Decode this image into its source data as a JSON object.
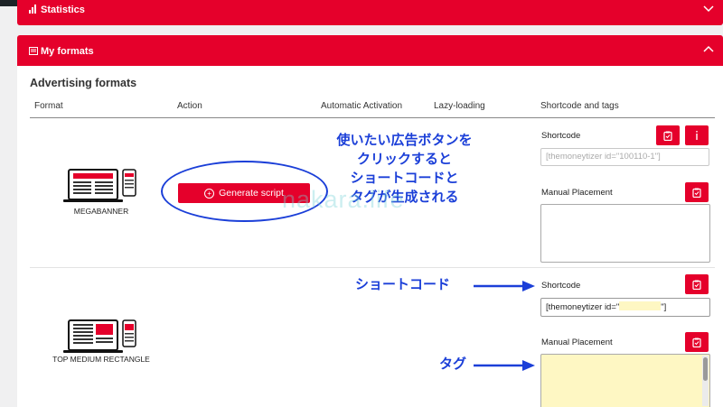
{
  "panels": {
    "statistics": {
      "title": "Statistics"
    },
    "my_formats": {
      "title": "My formats"
    }
  },
  "section_title": "Advertising formats",
  "table": {
    "headers": [
      "Format",
      "Action",
      "Automatic Activation",
      "Lazy-loading",
      "Shortcode and tags"
    ]
  },
  "rows": [
    {
      "format": "MEGABANNER",
      "action_label": "Generate script",
      "shortcode_label": "Shortcode",
      "shortcode_placeholder": "[themoneytizer id=\"100110-1\"]",
      "manual_label": "Manual Placement"
    },
    {
      "format": "TOP MEDIUM RECTANGLE",
      "shortcode_label": "Shortcode",
      "shortcode_prefix": "[themoneytizer id=\"",
      "shortcode_suffix": "\"]",
      "manual_label": "Manual Placement"
    }
  ],
  "annotations": {
    "callout_lines": [
      "使いたい広告ボタンを",
      "クリックすると",
      "ショートコードと",
      "タグが生成される"
    ],
    "shortcode_note": "ショートコード",
    "tag_note": "タグ",
    "watermark": "nakara.life"
  },
  "colors": {
    "brand_red": "#e5002b",
    "annotation_blue": "#1b3fd8",
    "highlight_yellow": "#fef7c3"
  },
  "icons": [
    "bar-chart-icon",
    "list-icon",
    "chevron-down-icon",
    "chevron-up-icon",
    "plus-circle-icon",
    "clipboard-icon",
    "info-icon",
    "laptop-phone-icon"
  ]
}
